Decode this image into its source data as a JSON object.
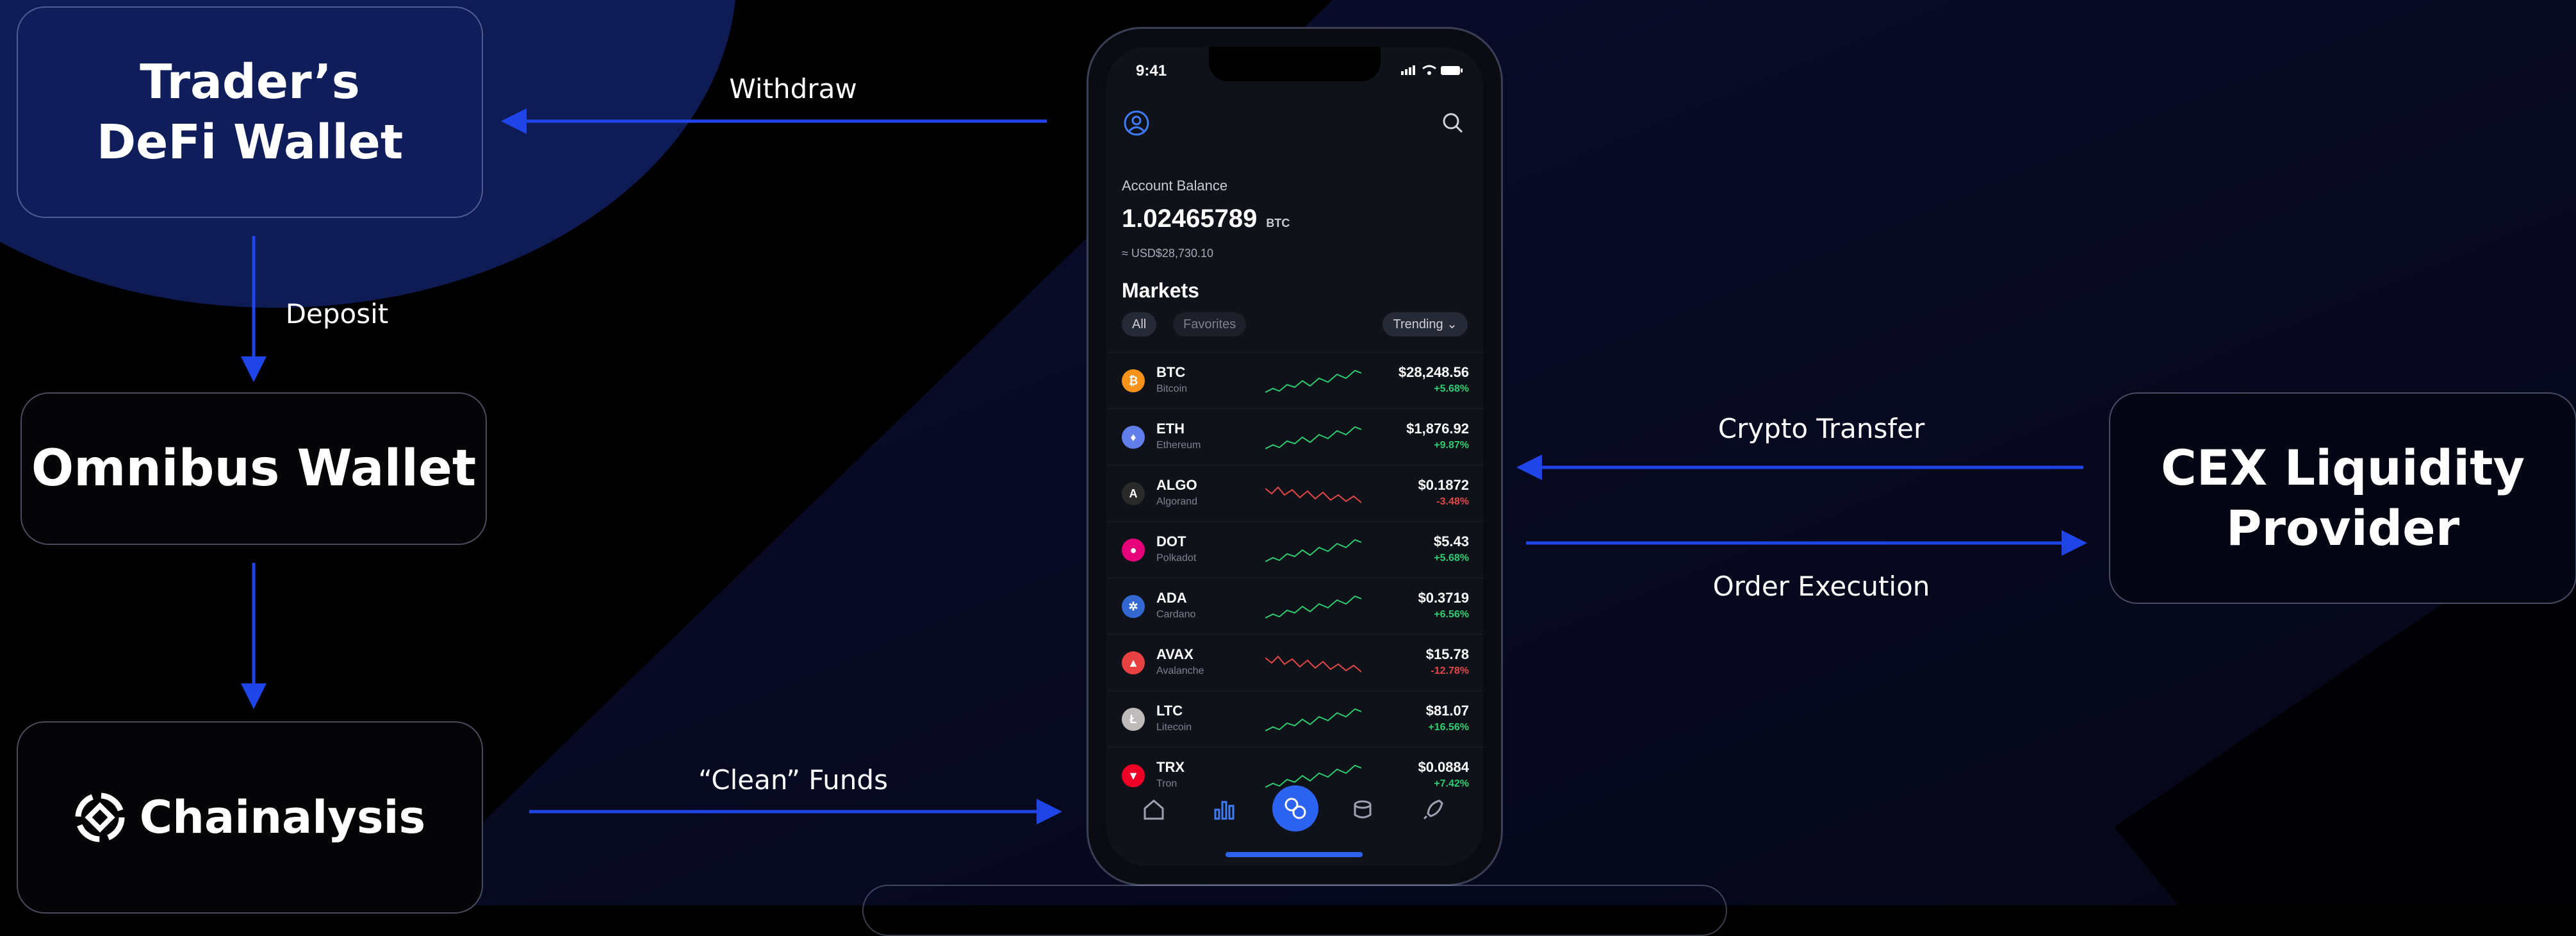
{
  "nodes": {
    "trader_wallet": "Trader’s\nDeFi Wallet",
    "omnibus_wallet": "Omnibus Wallet",
    "chainalysis": "Chainalysis",
    "cex_provider": "CEX Liquidity\nProvider"
  },
  "edges": {
    "withdraw": "Withdraw",
    "deposit": "Deposit",
    "clean_funds": "“Clean” Funds",
    "crypto_transfer": "Crypto Transfer",
    "order_execution": "Order Execution"
  },
  "colors": {
    "arrow": "#1f44e8",
    "accent": "#2b63f0",
    "up": "#2ecc71",
    "down": "#e04848"
  },
  "phone": {
    "time": "9:41",
    "status_icons": "signal wifi battery",
    "account_label": "Account Balance",
    "balance": "1.02465789",
    "balance_unit": "BTC",
    "balance_usd": "≈ USD$28,730.10",
    "markets_title": "Markets",
    "filters": [
      "All",
      "Favorites"
    ],
    "sort": "Trending ⌄",
    "coins": [
      {
        "symbol": "BTC",
        "name": "Bitcoin",
        "price": "$28,248.56",
        "change": "+5.68%",
        "trend": "up",
        "color": "#f7931a",
        "glyph": "₿"
      },
      {
        "symbol": "ETH",
        "name": "Ethereum",
        "price": "$1,876.92",
        "change": "+9.87%",
        "trend": "up",
        "color": "#627eea",
        "glyph": "♦"
      },
      {
        "symbol": "ALGO",
        "name": "Algorand",
        "price": "$0.1872",
        "change": "-3.48%",
        "trend": "down",
        "color": "#2a2a2a",
        "glyph": "A"
      },
      {
        "symbol": "DOT",
        "name": "Polkadot",
        "price": "$5.43",
        "change": "+5.68%",
        "trend": "up",
        "color": "#e6007a",
        "glyph": "●"
      },
      {
        "symbol": "ADA",
        "name": "Cardano",
        "price": "$0.3719",
        "change": "+6.56%",
        "trend": "up",
        "color": "#3468d1",
        "glyph": "✲"
      },
      {
        "symbol": "AVAX",
        "name": "Avalanche",
        "price": "$15.78",
        "change": "-12.78%",
        "trend": "down",
        "color": "#e84142",
        "glyph": "▲"
      },
      {
        "symbol": "LTC",
        "name": "Litecoin",
        "price": "$81.07",
        "change": "+16.56%",
        "trend": "up",
        "color": "#bfbbbb",
        "glyph": "Ł"
      },
      {
        "symbol": "TRX",
        "name": "Tron",
        "price": "$0.0884",
        "change": "+7.42%",
        "trend": "up",
        "color": "#ef0027",
        "glyph": "▼"
      }
    ],
    "nav_icons": [
      "home-icon",
      "markets-icon",
      "swap-icon",
      "wallet-icon",
      "rocket-icon"
    ]
  }
}
